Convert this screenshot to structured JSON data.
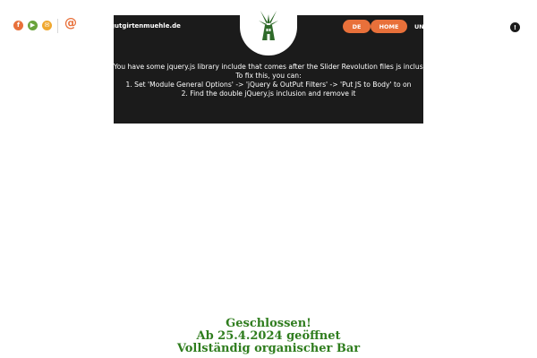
{
  "social": {
    "icons": [
      {
        "name": "facebook-icon",
        "glyph": "f",
        "color": "#e8703a"
      },
      {
        "name": "youtube-icon",
        "glyph": "▶",
        "color": "#6aa33b"
      },
      {
        "name": "email-icon",
        "glyph": "✉",
        "color": "#f0a830"
      }
    ],
    "at_glyph": "@"
  },
  "header": {
    "domain": "gutgirtenmuehle.de",
    "nav": {
      "de_label": "DE",
      "home_label": "HOME",
      "clipped_label": "UN"
    },
    "alert_glyph": "!"
  },
  "error_message": {
    "lines": [
      "You have some jquery.js library include that comes after the Slider Revolution files js inclusion.",
      "To fix this, you can:",
      "1. Set 'Module General Options' -> 'jQuery & OutPut Filters' -> 'Put JS to Body' to on",
      "2. Find the double jQuery.js inclusion and remove it"
    ]
  },
  "footer": {
    "line1": "Geschlossen!",
    "line2": "Ab 25.4.2024 geöffnet",
    "line3": "Vollständig organischer Bar"
  },
  "colors": {
    "accent": "#e8703a",
    "dark_panel": "#1b1b1b",
    "green_text": "#2f7d1e",
    "logo_green": "#2f6b2a"
  }
}
